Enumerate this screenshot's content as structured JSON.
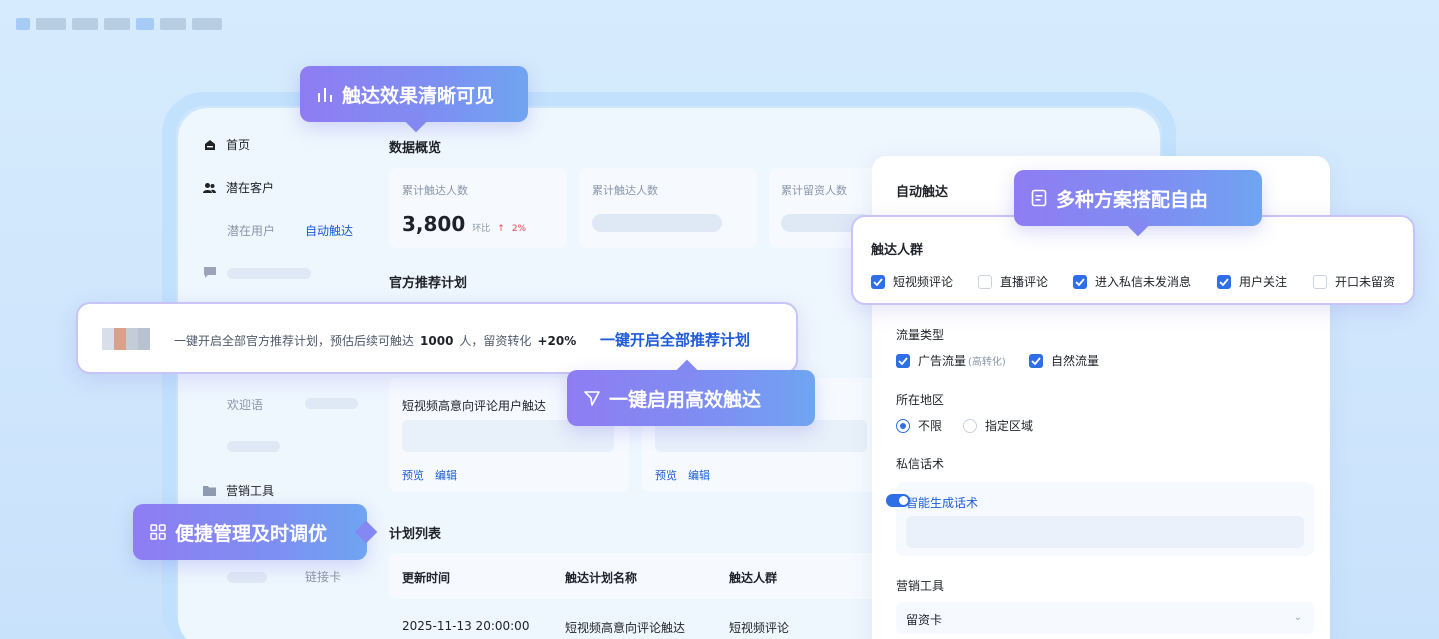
{
  "sidebar": {
    "home": "首页",
    "customers": "潜在客户",
    "sub_users": "潜在用户",
    "sub_auto": "自动触达",
    "welcome": "欢迎语",
    "marketing": "营销工具",
    "linkcard": "链接卡"
  },
  "overview": {
    "title": "数据概览",
    "card1_title": "累计触达人数",
    "card1_value": "3,800",
    "card1_ratio_label": "环比",
    "card1_ratio": "2%",
    "card2_title": "累计触达人数",
    "card3_title": "累计留资人数"
  },
  "recommend": {
    "title": "官方推荐计划",
    "plan1_title": "短视频高意向评论用户触达",
    "preview": "预览",
    "edit": "编辑"
  },
  "plan_list": {
    "title": "计划列表",
    "columns": [
      "更新时间",
      "触达计划名称",
      "触达人群"
    ],
    "rows": [
      [
        "2025-11-13 20:00:00",
        "短视频高意向评论触达",
        "短视频评论"
      ]
    ]
  },
  "panel": {
    "title": "自动触达",
    "audience_title": "触达人群",
    "audience_options": [
      {
        "label": "短视频评论",
        "checked": true
      },
      {
        "label": "直播评论",
        "checked": false
      },
      {
        "label": "进入私信未发消息",
        "checked": true
      },
      {
        "label": "用户关注",
        "checked": true
      },
      {
        "label": "开口未留资",
        "checked": false
      }
    ],
    "traffic_title": "流量类型",
    "traffic_ad": "广告流量",
    "traffic_ad_note": "(高转化)",
    "traffic_natural": "自然流量",
    "region_title": "所在地区",
    "region_unlimited": "不限",
    "region_specific": "指定区域",
    "script_title": "私信话术",
    "ai_script": "智能生成话术",
    "tool_title": "营销工具",
    "tool_value": "留资卡"
  },
  "banner": {
    "text_before": "一键开启全部官方推荐计划，预估后续可触达",
    "reach_count": "1000",
    "text_mid": "人，留资转化",
    "conversion": "+20%",
    "cta": "一键开启全部推荐计划"
  },
  "callouts": {
    "effect": "触达效果清晰可见",
    "plans": "多种方案搭配自由",
    "enable": "一键启用高效触达",
    "manage": "便捷管理及时调优"
  },
  "colors": {
    "accent": "#2f6ee6",
    "callout_purple": "#8f7cf3",
    "up_red": "#e5484d"
  }
}
